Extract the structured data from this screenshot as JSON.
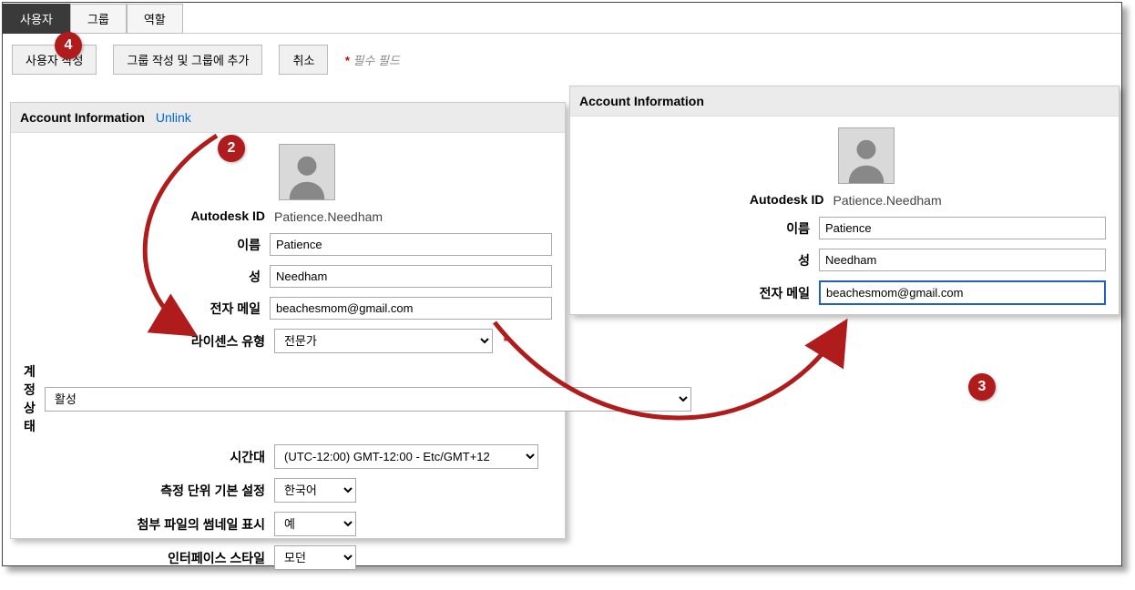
{
  "tabs": {
    "user": "사용자",
    "group": "그룹",
    "role": "역할"
  },
  "toolbar": {
    "create_user": "사용자 작성",
    "create_group": "그룹 작성 및 그룹에 추가",
    "cancel": "취소",
    "required_note": "필수 필드"
  },
  "panel_left": {
    "title": "Account Information",
    "unlink": "Unlink",
    "labels": {
      "autodesk_id": "Autodesk ID",
      "first_name": "이름",
      "last_name": "성",
      "email": "전자 메일",
      "license_type": "라이센스 유형",
      "account_status": "계정 상태",
      "timezone": "시간대",
      "units": "측정 단위 기본 설정",
      "thumbnail": "첨부 파일의 썸네일 표시",
      "interface": "인터페이스 스타일"
    },
    "values": {
      "autodesk_id": "Patience.Needham",
      "first_name": "Patience",
      "last_name": "Needham",
      "email": "beachesmom@gmail.com",
      "license_type": "전문가",
      "account_status": "활성",
      "timezone": "(UTC-12:00) GMT-12:00 - Etc/GMT+12",
      "units": "한국어",
      "thumbnail": "예",
      "interface": "모던"
    }
  },
  "panel_right": {
    "title": "Account Information",
    "labels": {
      "autodesk_id": "Autodesk ID",
      "first_name": "이름",
      "last_name": "성",
      "email": "전자 메일"
    },
    "values": {
      "autodesk_id": "Patience.Needham",
      "first_name": "Patience",
      "last_name": "Needham",
      "email": "beachesmom@gmail.com"
    }
  },
  "annotations": {
    "badge2": "2",
    "badge3": "3",
    "badge4": "4"
  }
}
